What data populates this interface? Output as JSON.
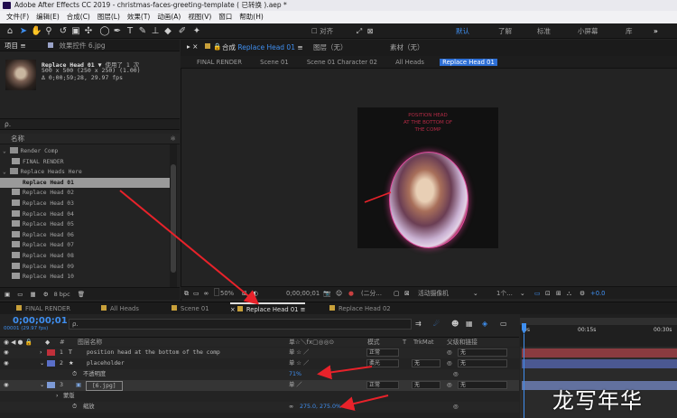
{
  "window": {
    "title": "Adobe After Effects CC 2019 - christmas-faces-greeting-template ( 已转换 ).aep *"
  },
  "menu": [
    "文件(F)",
    "编辑(E)",
    "合成(C)",
    "图层(L)",
    "效果(T)",
    "动画(A)",
    "视图(V)",
    "窗口",
    "帮助(H)"
  ],
  "toolbar": {
    "snap_label": "对齐",
    "workspaces": [
      "默认",
      "了解",
      "标准",
      "小屏幕",
      "库"
    ],
    "more": "»"
  },
  "project": {
    "tab_label": "项目",
    "effects_tab": "效果控件 6.jpg",
    "selected_name": "Replace Head 01 ▼",
    "used_count": "使用了 1 次",
    "dims": "500 x 500 (250 x 250) (1.00)",
    "duration": "Δ 0;00;59;28, 29.97 fps",
    "search_placeholder": "ρ.",
    "column_name": "名称",
    "items": [
      {
        "name": "Render Comp",
        "type": "folder"
      },
      {
        "name": "FINAL RENDER",
        "type": "comp"
      },
      {
        "name": "Replace Heads Here",
        "type": "folder"
      },
      {
        "name": "Replace Head 01",
        "type": "comp",
        "selected": true
      },
      {
        "name": "Replace Head 02",
        "type": "comp"
      },
      {
        "name": "Replace Head 03",
        "type": "comp"
      },
      {
        "name": "Replace Head 04",
        "type": "comp"
      },
      {
        "name": "Replace Head 05",
        "type": "comp"
      },
      {
        "name": "Replace Head 06",
        "type": "comp"
      },
      {
        "name": "Replace Head 07",
        "type": "comp"
      },
      {
        "name": "Replace Head 08",
        "type": "comp"
      },
      {
        "name": "Replace Head 09",
        "type": "comp"
      },
      {
        "name": "Replace Head 10",
        "type": "comp"
      }
    ],
    "footer_bpc": "8 bpc"
  },
  "composition": {
    "tab_prefix": "合成",
    "tab_name": "Replace Head 01",
    "layer_tab": "图层（无）",
    "footage_tab": "素材（无）",
    "breadcrumbs": [
      "FINAL RENDER",
      "Scene 01",
      "Scene 01 Character 02",
      "All Heads",
      "Replace Head 01"
    ],
    "canvas_text": [
      "POSITION HEAD",
      "AT THE BOTTOM OF",
      "THE COMP"
    ],
    "zoom": "50%",
    "timecode": "0;00;00;01",
    "resolution": "(二分…",
    "camera": "活动摄像机",
    "views": "1个…",
    "exposure": "+0.0"
  },
  "timeline": {
    "tabs": [
      {
        "label": "FINAL RENDER",
        "color": "#c8a03a"
      },
      {
        "label": "All Heads",
        "color": "#c8a03a"
      },
      {
        "label": "Scene 01",
        "color": "#c8a03a"
      },
      {
        "label": "Replace Head 01",
        "color": "#c8a03a",
        "active": true
      },
      {
        "label": "Replace Head 02",
        "color": "#c8a03a"
      }
    ],
    "timecode": "0;00;00;01",
    "fps_info": "00001 (29.97 fps)",
    "search_placeholder": "ρ.",
    "columns": {
      "layer_name": "图层名称",
      "switches": "单☆＼fx▢◎◎⊙",
      "mode": "模式",
      "t": "T",
      "trkmat": "TrkMat",
      "parent": "父级和链接"
    },
    "layers": [
      {
        "num": "1",
        "icon": "T",
        "name": "position head at the bottom of the comp",
        "mode": "正常",
        "trkmat": "",
        "parent": "无",
        "label_color": "#c0303a"
      },
      {
        "num": "2",
        "icon": "★",
        "name": "placeholder",
        "mode": "柔光",
        "trkmat": "无",
        "parent": "无",
        "label_color": "#5a6fc8"
      },
      {
        "prop": "不透明度",
        "value": "71%"
      },
      {
        "num": "3",
        "icon": "▣",
        "name": "[6.jpg]",
        "mode": "正常",
        "trkmat": "无",
        "parent": "无",
        "label_color": "#7d9ad6"
      },
      {
        "prop": "蒙版",
        "value": ""
      },
      {
        "prop": "缩放",
        "value": "275.0, 275.0%"
      }
    ],
    "ruler": [
      "0s",
      "00:15s",
      "00:30s"
    ]
  },
  "watermark": "龙写年华",
  "colors": {
    "accent": "#2d6fd6",
    "timecode": "#3f8ff0",
    "arrow": "#e8222a"
  }
}
